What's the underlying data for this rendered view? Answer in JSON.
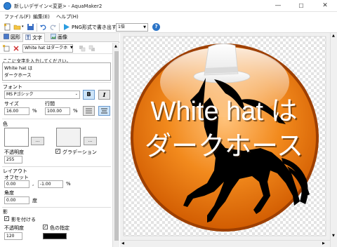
{
  "window": {
    "title": "新しいデザイン<変更> - AquaMaker2",
    "minimize": "—",
    "maximize": "☐",
    "close": "✕"
  },
  "menu": [
    "ファイル(F)",
    "編集(E)",
    "ヘルプ(H)"
  ],
  "toolbar": {
    "png_export": "PNG形式で書き出す",
    "scale": "1倍",
    "help": "?"
  },
  "tabs": [
    "図形",
    "文字",
    "画像"
  ],
  "layer_select": "White hat はダークホ",
  "text_section": {
    "prompt": "ここに文字を入力してください。",
    "text_line1": "White hat は",
    "text_line2": "ダークホース"
  },
  "font_section": {
    "title": "フォント",
    "font_name": "MS Pゴシック",
    "bold": "B",
    "italic": "I",
    "size_label": "サイズ",
    "size_value": "16.00",
    "size_unit": "%",
    "line_spacing_label": "行間",
    "line_spacing_value": "100.00",
    "line_spacing_unit": "%"
  },
  "color_section": {
    "title": "色",
    "picker1": "...",
    "picker2": "...",
    "opacity_label": "不透明度",
    "opacity_value": "255",
    "gradient_label": "グラデーション",
    "gradient_checked": true
  },
  "layout_section": {
    "title": "レイアウト",
    "offset_label": "オフセット",
    "offset_x": "0.00",
    "offset_sep": ",",
    "offset_y": "-1.00",
    "offset_unit": "%",
    "angle_label": "角度",
    "angle_value": "0.00",
    "angle_unit": "度"
  },
  "shadow_section": {
    "title": "影",
    "enable_label": "影を付ける",
    "enable_checked": true,
    "opacity_label": "不透明度",
    "opacity_value": "120",
    "color_label": "色の指定",
    "color_checked": true
  },
  "canvas": {
    "line1": "White hat は",
    "line2": "ダークホース",
    "orb_color": "#ee7f12",
    "text_color": "#ffffff"
  }
}
